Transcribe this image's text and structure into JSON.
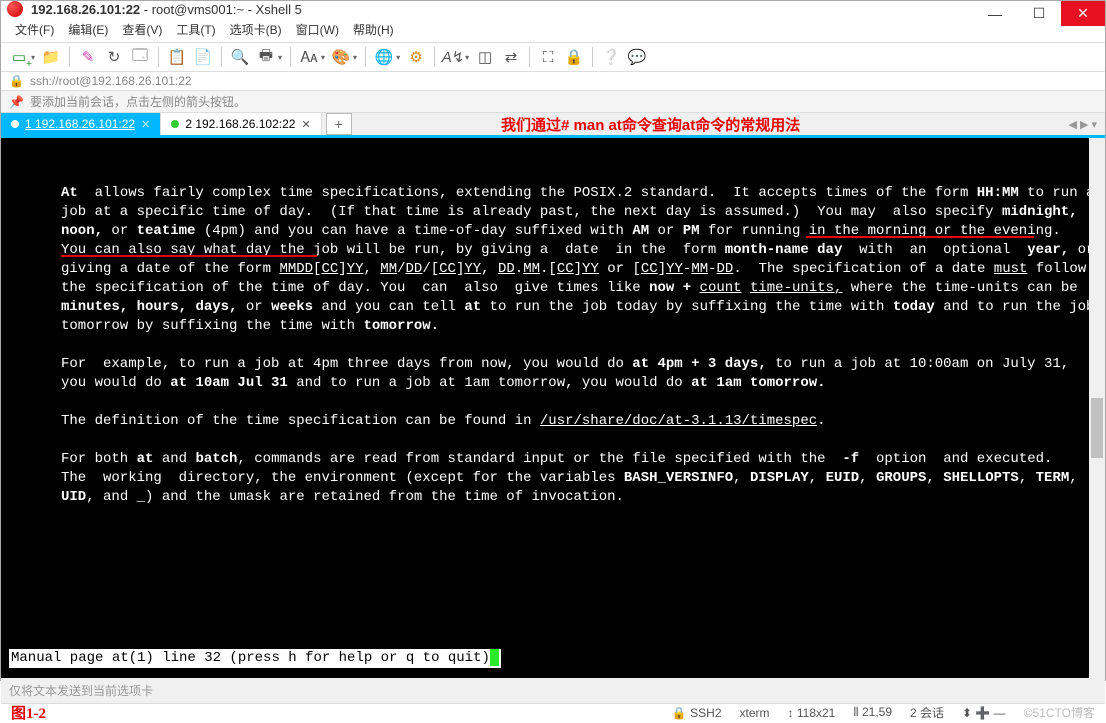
{
  "window": {
    "title_ip": "192.168.26.101:22",
    "title_rest": "root@vms001:~ - Xshell 5"
  },
  "menu": [
    "文件(F)",
    "编辑(E)",
    "查看(V)",
    "工具(T)",
    "选项卡(B)",
    "窗口(W)",
    "帮助(H)"
  ],
  "address": {
    "protocol_icon": "🔒",
    "url": "ssh://root@192.168.26.101:22"
  },
  "tip": {
    "icon": "📌",
    "text": "要添加当前会话，点击左侧的箭头按钮。"
  },
  "tabs": [
    {
      "label": "1 192.168.26.101:22",
      "active": true
    },
    {
      "label": "2 192.168.26.102:22",
      "active": false
    }
  ],
  "annotation_top": "我们通过# man at命令查询at命令的常规用法",
  "terminal": {
    "p1_pre": "At",
    "p1_a": "  allows fairly complex time specifications, extending the POSIX.2 standard.  It accepts times of the form ",
    "p1_b": "HH:MM",
    "p1_c": " to run a job at a specific time of day.  (If that time is already past, the next day is assumed.)  You may  also specify ",
    "p1_d": "midnight,",
    "p1_e": " ",
    "p1_f": "noon,",
    "p1_g": " or ",
    "p1_h": "teatime",
    "p1_i": " (4pm) and you can have a time-of-day suffixed with ",
    "p1_j": "AM",
    "p1_k": " or ",
    "p1_l": "PM",
    "p1_m": " for running in the morning or the evening.  You can also say what day the job will be run, by giving a  date  in the  form ",
    "p1_n": "month-name",
    "p1_o": " ",
    "p1_p": "day",
    "p1_q": "  with  an  optional  ",
    "p1_r": "year,",
    "p1_s": " or giving a date of the form ",
    "u1": "MMDD",
    "u1b": "[",
    "u1c": "CC",
    "u1d": "]",
    "u1e": "YY",
    "c1": ", ",
    "u2": "MM",
    "c2": "/",
    "u3": "DD",
    "c3": "/[",
    "u4": "CC",
    "c4": "]",
    "u5": "YY",
    "c5": ", ",
    "u6": "DD",
    "c6": ".",
    "u7": "MM",
    "c7": ".[",
    "u8": "CC",
    "c8": "]",
    "u9": "YY",
    "c9": " or [",
    "u10": "CC",
    "c10": "]",
    "u11": "YY",
    "c11": "-",
    "u12": "MM",
    "c12": "-",
    "u13": "DD",
    "p1_t": ".  The specification of a date ",
    "u14": "must",
    "p1_u": " follow the specification of the time of day. You  can  also  give times like ",
    "p1_v": "now",
    "p1_w": " ",
    "p1_x": "+",
    "p1_y": " ",
    "u15": "count",
    "p1_z": " ",
    "u16": "time-units,",
    "p1_aa": " where the time-units can be ",
    "p1_ab": "minutes,",
    "p1_ac": " ",
    "p1_ad": "hours,",
    "p1_ae": " ",
    "p1_af": "days,",
    "p1_ag": " or ",
    "p1_ah": "weeks",
    "p1_ai": " and you can tell ",
    "p1_aj": "at",
    "p1_ak": " to run the job today by suffixing the time with ",
    "p1_al": "today",
    "p1_am": " and to run the job  tomorrow by suffixing the time with ",
    "p1_an": "tomorrow.",
    "p2_a": "For  example, to run a job at 4pm three days from now, you would do ",
    "p2_b": "at 4pm + 3 days,",
    "p2_c": " to run a job at 10:00am on July 31, you would do ",
    "p2_d": "at 10am Jul 31",
    "p2_e": " and to run a job at 1am tomorrow, you would do ",
    "p2_f": "at 1am tomorrow.",
    "p3_a": "The definition of the time specification can be found in ",
    "p3_b": "/usr/share/doc/at-3.1.13/timespec",
    "p3_c": ".",
    "p4_a": "For both ",
    "p4_b": "at",
    "p4_c": " and ",
    "p4_d": "batch",
    "p4_e": ", commands are read from standard input or the file specified with the  ",
    "p4_f": "-f",
    "p4_g": "  option  and executed.   The  working  directory, the environment (except for the variables ",
    "p4_h": "BASH_VERSINFO",
    "p4_i": ", ",
    "p4_j": "DISPLAY",
    "p4_k": ", ",
    "p4_l": "EUID",
    "p4_m": ", ",
    "p4_n": "GROUPS",
    "p4_o": ", ",
    "p4_p": "SHELLOPTS",
    "p4_q": ", ",
    "p4_r": "TERM",
    "p4_s": ", ",
    "p4_t": "UID",
    "p4_u": ", and ",
    "p4_v": "_",
    "p4_w": ") and the umask are retained from the time of invocation.",
    "pager": "Manual page at(1) line 32 (press h for help or q to quit)"
  },
  "bottom_placeholder": "仅将文本发送到当前选项卡",
  "fig_label": "图1-2",
  "status": {
    "proto": "SSH2",
    "term": "xterm",
    "size": "118x21",
    "pos": "21,59",
    "sessions": "2 会话",
    "watermark": "©51CTO博客"
  }
}
